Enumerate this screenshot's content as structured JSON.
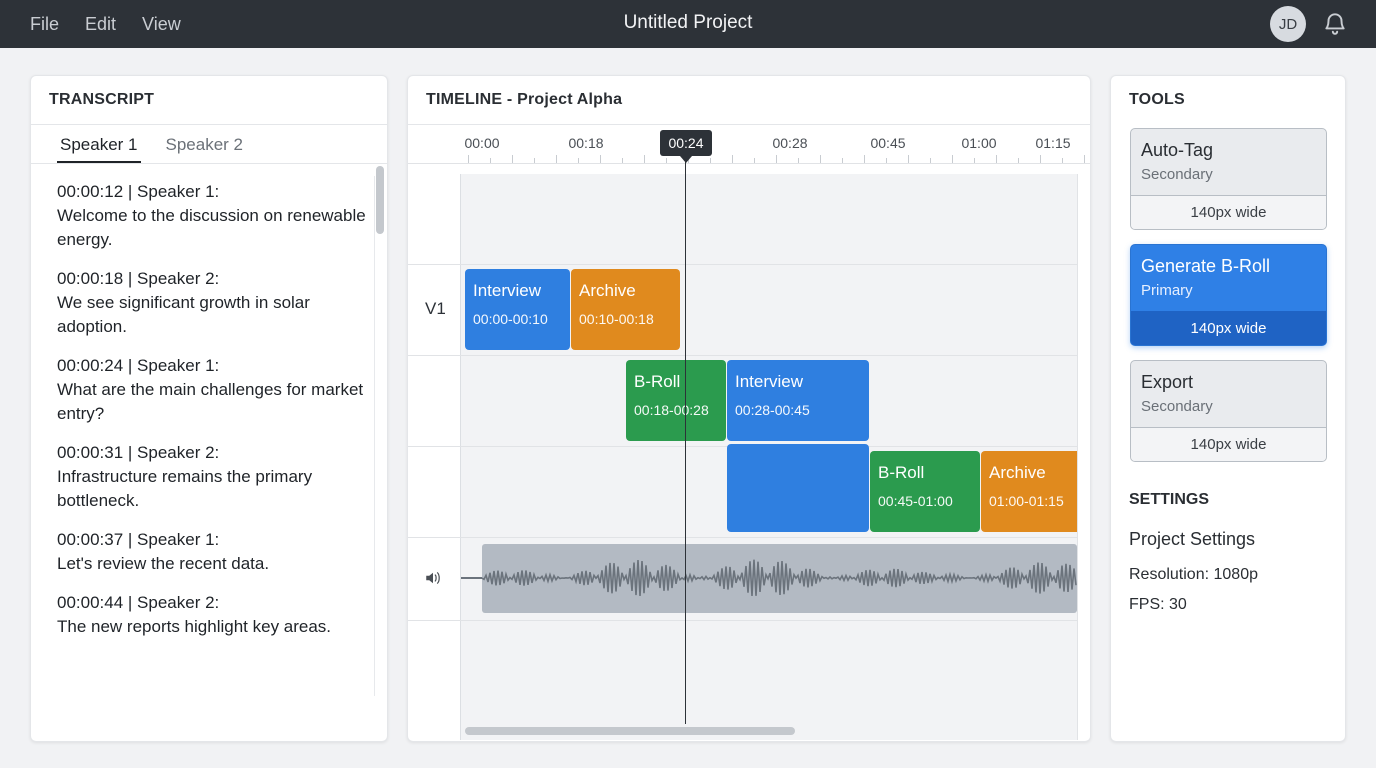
{
  "menu": [
    {
      "label": "File"
    },
    {
      "label": "Edit"
    },
    {
      "label": "View"
    }
  ],
  "app_title": "Untitled Project",
  "user_initials": "JD",
  "transcript": {
    "title": "TRANSCRIPT",
    "tabs": [
      {
        "label": "Speaker 1",
        "active": true
      },
      {
        "label": "Speaker 2",
        "active": false
      }
    ],
    "entries": [
      {
        "ts": "00:00:12 | Speaker 1:",
        "text": "Welcome to the discussion on renewable energy."
      },
      {
        "ts": "00:00:18 | Speaker 2:",
        "text": "We see significant growth in solar adoption."
      },
      {
        "ts": "00:00:24 | Speaker 1:",
        "text": "What are the main challenges for market entry?"
      },
      {
        "ts": "00:00:31 | Speaker 2:",
        "text": "Infrastructure remains the primary bottleneck."
      },
      {
        "ts": "00:00:37 | Speaker 1:",
        "text": "Let's review the recent data."
      },
      {
        "ts": "00:00:44 | Speaker 2:",
        "text": "The new reports highlight key areas."
      }
    ]
  },
  "timeline": {
    "title": "TIMELINE - Project Alpha",
    "ticks": [
      "00:00",
      "00:18",
      "00:28",
      "00:45",
      "01:00",
      "01:15"
    ],
    "playhead": "00:24",
    "track_label": "V1",
    "clips": [
      {
        "name": "Interview",
        "range": "00:00-00:10",
        "color": "blue"
      },
      {
        "name": "Archive",
        "range": "00:10-00:18",
        "color": "orange"
      },
      {
        "name": "B-Roll",
        "range": "00:18-00:28",
        "color": "green"
      },
      {
        "name": "Interview",
        "range": "00:28-00:45",
        "color": "blue"
      },
      {
        "name": "",
        "range": "",
        "color": "blue"
      },
      {
        "name": "B-Roll",
        "range": "00:45-01:00",
        "color": "green"
      },
      {
        "name": "Archive",
        "range": "01:00-01:15",
        "color": "orange"
      }
    ],
    "colors": {
      "blue": "#2f7fe0",
      "orange": "#e08a1e",
      "green": "#2b9b4e"
    }
  },
  "tools": {
    "title": "TOOLS",
    "buttons": [
      {
        "name": "Auto-Tag",
        "sub": "Secondary",
        "foot": "140px wide"
      },
      {
        "name": "Generate B-Roll",
        "sub": "Primary",
        "foot": "140px wide"
      },
      {
        "name": "Export",
        "sub": "Secondary",
        "foot": "140px wide"
      }
    ],
    "accent": "#2f80e6"
  },
  "settings": {
    "title": "SETTINGS",
    "subtitle": "Project Settings",
    "resolution": "Resolution: 1080p",
    "fps": "FPS: 30"
  },
  "icons": {
    "notifications": "bell-icon",
    "audio": "speaker-icon"
  }
}
